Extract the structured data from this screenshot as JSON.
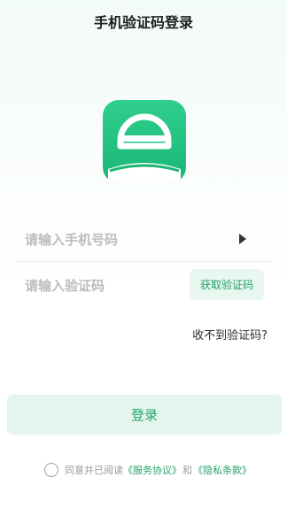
{
  "header": {
    "title": "手机验证码登录"
  },
  "logo": {
    "icon": "steering-wheel-car-icon",
    "color": "#22c07f"
  },
  "form": {
    "phone_placeholder": "请输入手机号码",
    "code_placeholder": "请输入验证码",
    "get_code_label": "获取验证码",
    "no_code_label": "收不到验证码?"
  },
  "login": {
    "label": "登录"
  },
  "agreement": {
    "prefix": "同意并已阅读",
    "terms_link": "《服务协议》",
    "connector": "和",
    "privacy_link": "《隐私条款》"
  },
  "colors": {
    "accent": "#25a46b",
    "button_bg": "#e3f5ec"
  }
}
